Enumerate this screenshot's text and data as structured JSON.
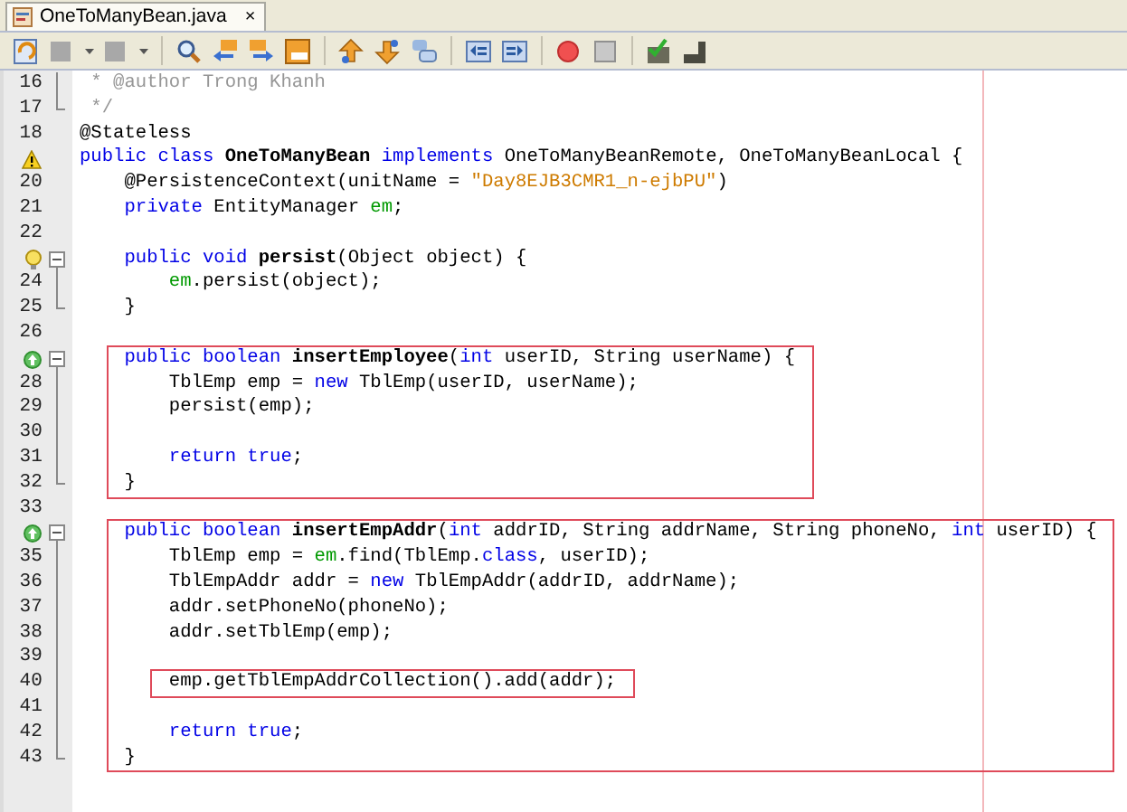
{
  "tabs": [
    {
      "title": "OneToManyBean.java",
      "close": "×",
      "selected": true
    }
  ],
  "editor": {
    "items": [
      {
        "kind": "line",
        "number": "16",
        "fold": {
          "kind": "line"
        },
        "tokens": [
          {
            "text": " * @author Trong Khanh",
            "kind": "comment"
          }
        ]
      },
      {
        "kind": "line",
        "number": "17",
        "fold": {
          "kind": "end"
        },
        "tokens": [
          {
            "text": " */",
            "kind": "comment"
          }
        ]
      },
      {
        "kind": "line",
        "number": "18",
        "tokens": [
          {
            "text": "@Stateless",
            "kind": "plain"
          }
        ]
      },
      {
        "kind": "line",
        "marker": {
          "kind": "warning"
        },
        "tokens": [
          {
            "text": "public class ",
            "kind": "keyword"
          },
          {
            "text": "OneToManyBean",
            "kind": "bold"
          },
          {
            "text": " implements ",
            "kind": "keyword"
          },
          {
            "text": "OneToManyBeanRemote, OneToManyBeanLocal {",
            "kind": "plain"
          }
        ]
      },
      {
        "kind": "line",
        "number": "20",
        "tokens": [
          {
            "text": "    @PersistenceContext(unitName = ",
            "kind": "plain"
          },
          {
            "text": "\"Day8EJB3CMR1_n-ejbPU\"",
            "kind": "string"
          },
          {
            "text": ")",
            "kind": "plain"
          }
        ]
      },
      {
        "kind": "line",
        "number": "21",
        "tokens": [
          {
            "text": "    private",
            "kind": "keyword"
          },
          {
            "text": " EntityManager ",
            "kind": "plain"
          },
          {
            "text": "em",
            "kind": "field"
          },
          {
            "text": ";",
            "kind": "plain"
          }
        ]
      },
      {
        "kind": "line",
        "number": "22"
      },
      {
        "kind": "line",
        "marker": {
          "kind": "hint"
        },
        "fold": {
          "kind": "start"
        },
        "tokens": [
          {
            "text": "    public void ",
            "kind": "keyword"
          },
          {
            "text": "persist",
            "kind": "bold"
          },
          {
            "text": "(Object object) {",
            "kind": "plain"
          }
        ]
      },
      {
        "kind": "line",
        "number": "24",
        "fold": {
          "kind": "line"
        },
        "tokens": [
          {
            "text": "        em",
            "kind": "field"
          },
          {
            "text": ".persist(object);",
            "kind": "plain"
          }
        ]
      },
      {
        "kind": "line",
        "number": "25",
        "fold": {
          "kind": "end"
        },
        "tokens": [
          {
            "text": "    }",
            "kind": "plain"
          }
        ]
      },
      {
        "kind": "line",
        "number": "26"
      },
      {
        "kind": "box",
        "children": [
          {
            "kind": "line",
            "marker": {
              "kind": "override"
            },
            "fold": {
              "kind": "start"
            },
            "tokens": [
              {
                "text": "    public boolean ",
                "kind": "keyword"
              },
              {
                "text": "insertEmployee",
                "kind": "bold"
              },
              {
                "text": "(",
                "kind": "plain"
              },
              {
                "text": "int",
                "kind": "keyword"
              },
              {
                "text": " userID, String userName) {",
                "kind": "plain"
              }
            ]
          },
          {
            "kind": "line",
            "number": "28",
            "fold": {
              "kind": "line"
            },
            "tokens": [
              {
                "text": "        TblEmp emp = ",
                "kind": "plain"
              },
              {
                "text": "new",
                "kind": "keyword"
              },
              {
                "text": " TblEmp(userID, userName);",
                "kind": "plain"
              }
            ]
          },
          {
            "kind": "line",
            "number": "29",
            "fold": {
              "kind": "line"
            },
            "tokens": [
              {
                "text": "        persist(emp);",
                "kind": "plain"
              }
            ]
          },
          {
            "kind": "line",
            "number": "30",
            "fold": {
              "kind": "line"
            }
          },
          {
            "kind": "line",
            "number": "31",
            "fold": {
              "kind": "line"
            },
            "tokens": [
              {
                "text": "        return true",
                "kind": "keyword"
              },
              {
                "text": ";",
                "kind": "plain"
              }
            ]
          },
          {
            "kind": "line",
            "number": "32",
            "fold": {
              "kind": "end"
            },
            "tokens": [
              {
                "text": "    }",
                "kind": "plain"
              }
            ]
          }
        ]
      },
      {
        "kind": "line",
        "number": "33"
      },
      {
        "kind": "box",
        "children": [
          {
            "kind": "line",
            "marker": {
              "kind": "override"
            },
            "fold": {
              "kind": "start"
            },
            "tokens": [
              {
                "text": "    public boolean ",
                "kind": "keyword"
              },
              {
                "text": "insertEmpAddr",
                "kind": "bold"
              },
              {
                "text": "(",
                "kind": "plain"
              },
              {
                "text": "int",
                "kind": "keyword"
              },
              {
                "text": " addrID, String addrName, String phoneNo, ",
                "kind": "plain"
              },
              {
                "text": "int",
                "kind": "keyword"
              },
              {
                "text": " userID) {",
                "kind": "plain"
              }
            ]
          },
          {
            "kind": "line",
            "number": "35",
            "fold": {
              "kind": "line"
            },
            "tokens": [
              {
                "text": "        TblEmp emp = ",
                "kind": "plain"
              },
              {
                "text": "em",
                "kind": "field"
              },
              {
                "text": ".find(TblEmp.",
                "kind": "plain"
              },
              {
                "text": "class",
                "kind": "keyword"
              },
              {
                "text": ", userID);",
                "kind": "plain"
              }
            ]
          },
          {
            "kind": "line",
            "number": "36",
            "fold": {
              "kind": "line"
            },
            "tokens": [
              {
                "text": "        TblEmpAddr addr = ",
                "kind": "plain"
              },
              {
                "text": "new",
                "kind": "keyword"
              },
              {
                "text": " TblEmpAddr(addrID, addrName);",
                "kind": "plain"
              }
            ]
          },
          {
            "kind": "line",
            "number": "37",
            "fold": {
              "kind": "line"
            },
            "tokens": [
              {
                "text": "        addr.setPhoneNo(phoneNo);",
                "kind": "plain"
              }
            ]
          },
          {
            "kind": "line",
            "number": "38",
            "fold": {
              "kind": "line"
            },
            "tokens": [
              {
                "text": "        addr.setTblEmp(emp);",
                "kind": "plain"
              }
            ]
          },
          {
            "kind": "line",
            "number": "39",
            "fold": {
              "kind": "line"
            }
          },
          {
            "kind": "box",
            "children": [
              {
                "kind": "line",
                "number": "40",
                "fold": {
                  "kind": "line"
                },
                "tokens": [
                  {
                    "text": "        emp.getTblEmpAddrCollection().add(addr);",
                    "kind": "plain"
                  }
                ]
              }
            ]
          },
          {
            "kind": "line",
            "number": "41",
            "fold": {
              "kind": "line"
            }
          },
          {
            "kind": "line",
            "number": "42",
            "fold": {
              "kind": "line"
            },
            "tokens": [
              {
                "text": "        return true",
                "kind": "keyword"
              },
              {
                "text": ";",
                "kind": "plain"
              }
            ]
          },
          {
            "kind": "line",
            "number": "43",
            "fold": {
              "kind": "end"
            },
            "tokens": [
              {
                "text": "    }",
                "kind": "plain"
              }
            ]
          }
        ]
      }
    ]
  }
}
